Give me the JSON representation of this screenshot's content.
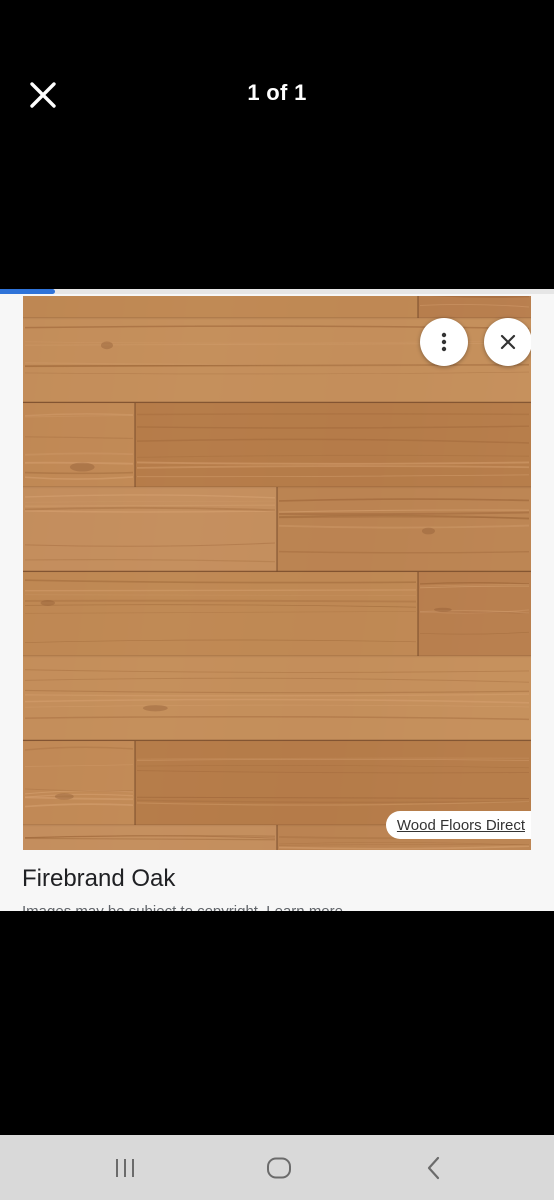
{
  "header": {
    "counter": "1 of 1",
    "close_icon": "close-icon"
  },
  "progress": {
    "fraction": 0.1,
    "color": "#2f73d8"
  },
  "viewer": {
    "image_subject": "wood plank flooring",
    "more_icon": "more-vertical-icon",
    "dismiss_icon": "close-icon",
    "source_label": "Wood Floors Direct",
    "title": "Firebrand Oak",
    "subtitle": "Images may be subject to copyright. Learn more"
  },
  "navbar": {
    "recent_icon": "recent-apps-icon",
    "home_icon": "home-icon",
    "back_icon": "back-icon"
  }
}
